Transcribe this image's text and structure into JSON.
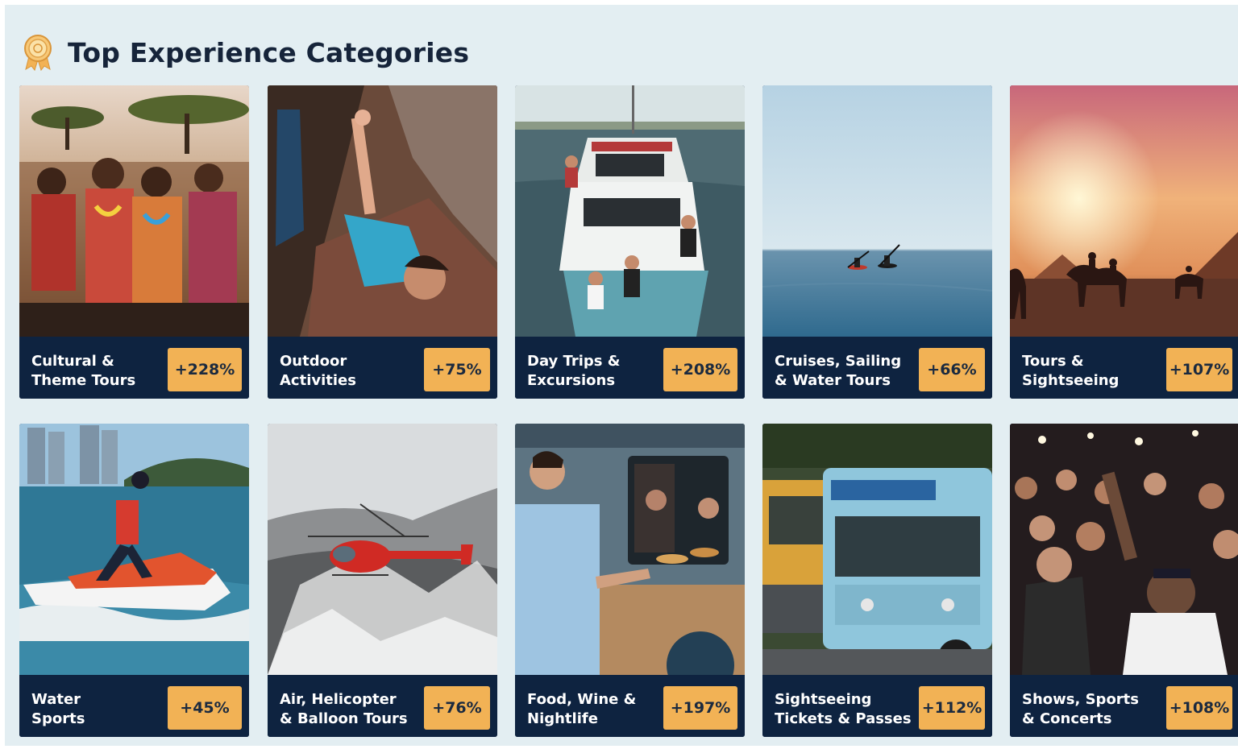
{
  "section": {
    "title": "Top Experience Categories",
    "icon": "award-medal-icon",
    "accent": "#f2b255",
    "card_bg": "#0e2340"
  },
  "cards": [
    {
      "label": "Cultural &\nTheme Tours",
      "growth": "+228%",
      "image": "tribal-people-photo"
    },
    {
      "label": "Outdoor\nActivities",
      "growth": "+75%",
      "image": "rock-climber-photo"
    },
    {
      "label": "Day Trips &\nExcursions",
      "growth": "+208%",
      "image": "boat-passengers-photo"
    },
    {
      "label": "Cruises, Sailing\n& Water Tours",
      "growth": "+66%",
      "image": "kayakers-sea-photo"
    },
    {
      "label": "Tours &\nSightseeing",
      "growth": "+107%",
      "image": "camels-pyramids-photo"
    },
    {
      "label": "Water\nSports",
      "growth": "+45%",
      "image": "jet-ski-photo"
    },
    {
      "label": "Air, Helicopter\n& Balloon Tours",
      "growth": "+76%",
      "image": "helicopter-photo"
    },
    {
      "label": "Food, Wine &\nNightlife",
      "growth": "+197%",
      "image": "food-truck-photo"
    },
    {
      "label": "Sightseeing\nTickets & Passes",
      "growth": "+112%",
      "image": "trolley-bus-photo"
    },
    {
      "label": "Shows, Sports\n& Concerts",
      "growth": "+108%",
      "image": "concert-crowd-photo"
    }
  ]
}
